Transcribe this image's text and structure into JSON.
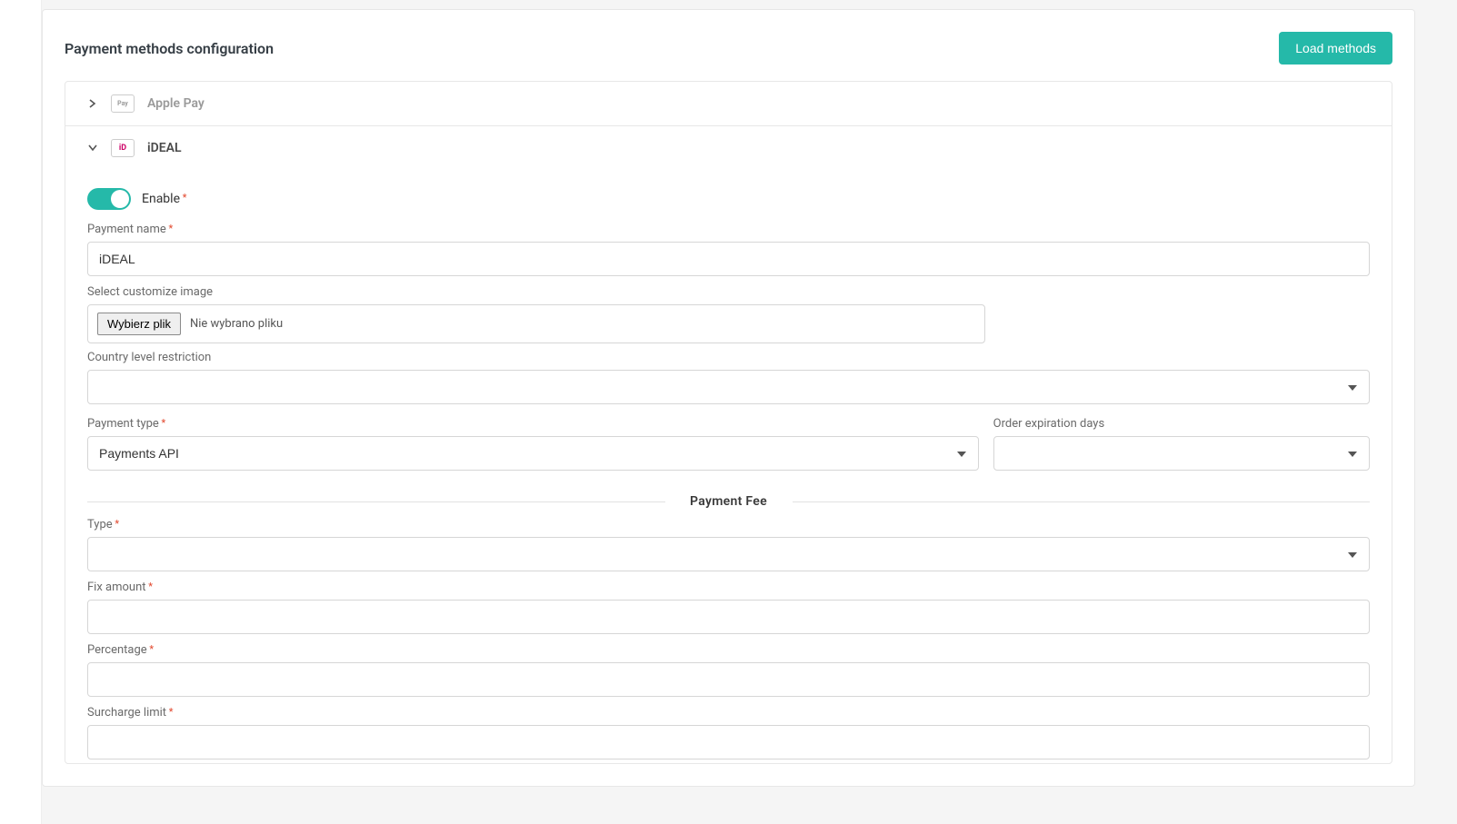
{
  "header": {
    "title": "Payment methods configuration",
    "load_button": "Load methods"
  },
  "accordion": {
    "apple_pay_label": "Apple Pay",
    "ideal_label": "iDEAL",
    "apple_pay_badge": "Pay",
    "ideal_badge": "iD"
  },
  "form": {
    "enable_label": "Enable",
    "payment_name_label": "Payment name",
    "payment_name_value": "iDEAL",
    "image_label": "Select customize image",
    "file_btn": "Wybierz plik",
    "file_status": "Nie wybrano pliku",
    "country_label": "Country level restriction",
    "payment_type_label": "Payment type",
    "payment_type_value": "Payments API",
    "expiration_label": "Order expiration days",
    "fee_heading": "Payment Fee",
    "type_label": "Type",
    "fix_label": "Fix amount",
    "pct_label": "Percentage",
    "limit_label": "Surcharge limit"
  }
}
